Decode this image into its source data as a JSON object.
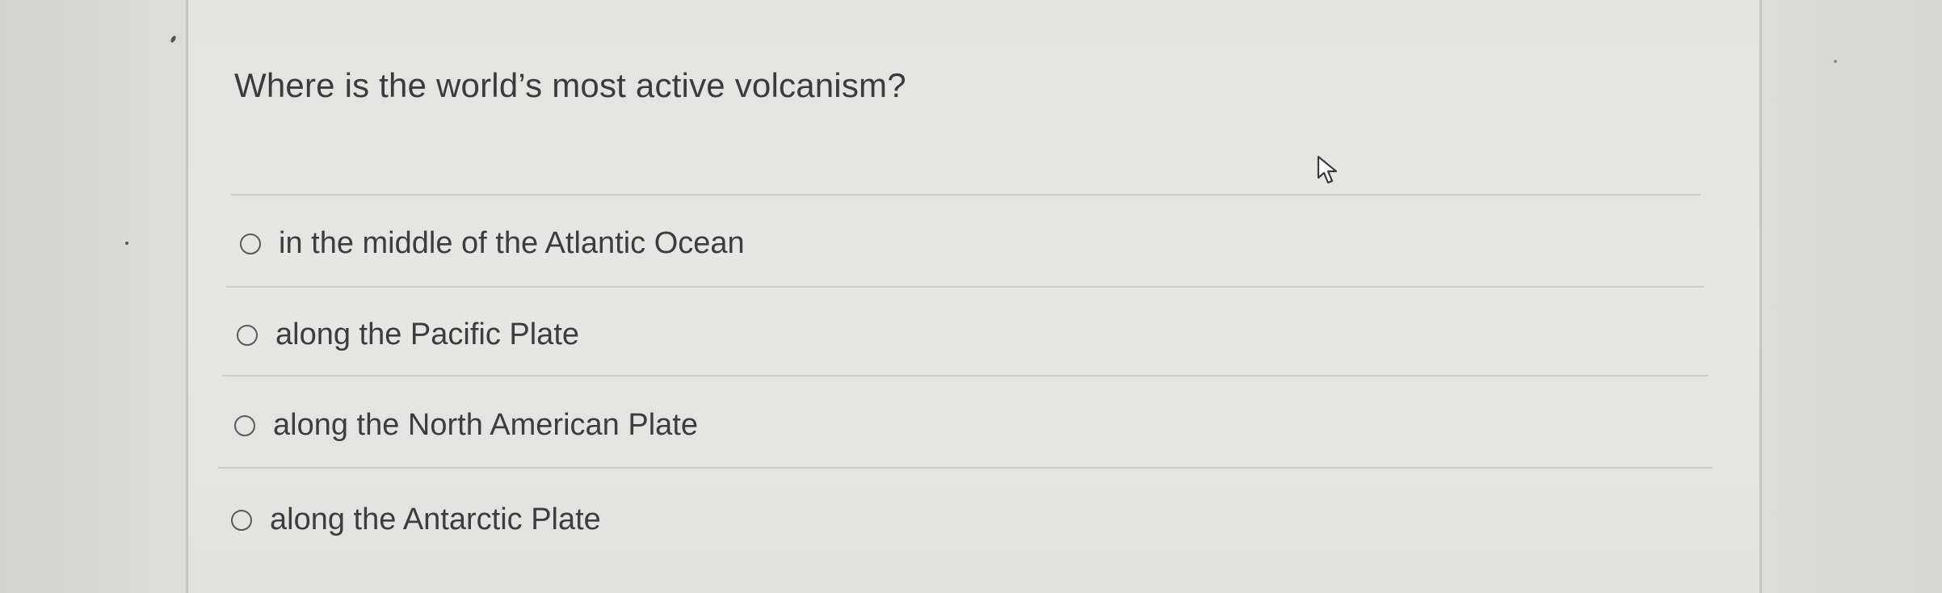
{
  "quiz": {
    "question": "Where is the world’s most active volcanism?",
    "options": [
      {
        "label": "in the middle of the Atlantic Ocean",
        "selected": false
      },
      {
        "label": "along the Pacific Plate",
        "selected": false
      },
      {
        "label": "along the North American Plate",
        "selected": false
      },
      {
        "label": "along the Antarctic Plate",
        "selected": false
      }
    ]
  },
  "icons": {
    "cursor": "hand-pointer-icon",
    "radio": "radio-unselected-icon"
  },
  "colors": {
    "text": "#3b3b3b",
    "radio_border": "#5a5a5a",
    "divider": "#cdcdcb"
  }
}
